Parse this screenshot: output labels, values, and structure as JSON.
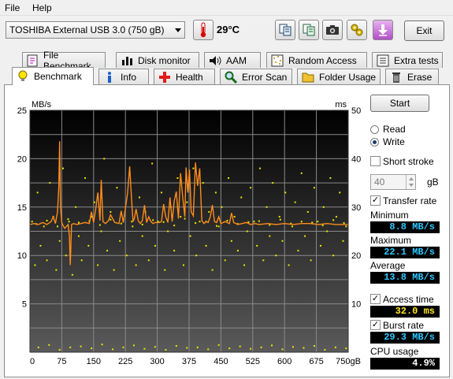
{
  "menu": {
    "file": "File",
    "help": "Help"
  },
  "toolbar": {
    "drive": "TOSHIBA External USB 3.0 (750 gB)",
    "temperature": "29°C",
    "exit_label": "Exit"
  },
  "tabs_top": [
    {
      "label": "File Benchmark",
      "icon": "file-benchmark-icon"
    },
    {
      "label": "Disk monitor",
      "icon": "disk-monitor-icon"
    },
    {
      "label": "AAM",
      "icon": "speaker-icon"
    },
    {
      "label": "Random Access",
      "icon": "random-access-icon"
    },
    {
      "label": "Extra tests",
      "icon": "extra-tests-icon"
    }
  ],
  "tabs_bottom": [
    {
      "label": "Benchmark",
      "icon": "lightbulb-icon"
    },
    {
      "label": "Info",
      "icon": "info-icon"
    },
    {
      "label": "Health",
      "icon": "health-cross-icon"
    },
    {
      "label": "Error Scan",
      "icon": "magnifier-icon"
    },
    {
      "label": "Folder Usage",
      "icon": "folder-icon"
    },
    {
      "label": "Erase",
      "icon": "trash-icon"
    }
  ],
  "side": {
    "start_label": "Start",
    "read_label": "Read",
    "write_label": "Write",
    "mode": "write",
    "short_stroke_label": "Short stroke",
    "short_stroke_checked": false,
    "short_stroke_value": "40",
    "short_stroke_unit": "gB",
    "transfer_rate_label": "Transfer rate",
    "transfer_rate_checked": true,
    "minimum_label": "Minimum",
    "minimum_value": "8.8 MB/s",
    "maximum_label": "Maximum",
    "maximum_value": "22.1 MB/s",
    "average_label": "Average",
    "average_value": "13.8 MB/s",
    "access_time_label": "Access time",
    "access_time_checked": true,
    "access_time_value": "32.0 ms",
    "burst_rate_label": "Burst rate",
    "burst_rate_checked": true,
    "burst_rate_value": "29.3 MB/s",
    "cpu_label": "CPU usage",
    "cpu_value": "4.9%"
  },
  "colors": {
    "chart_bg_top": "#000000",
    "chart_bg_bottom": "#5a5a5a",
    "transfer_line": "#ff8c1a",
    "access_points": "#e8e800",
    "grid": "#8a8a8a"
  },
  "chart_data": {
    "type": "line",
    "title": "",
    "ylabel": "MB/s",
    "y2label": "ms",
    "xunit": "gB",
    "x_ticks": [
      "0",
      "75",
      "150",
      "225",
      "300",
      "375",
      "450",
      "525",
      "600",
      "675",
      "750gB"
    ],
    "y_ticks": [
      "25",
      "20",
      "15",
      "10",
      "5"
    ],
    "y2_ticks": [
      "50",
      "40",
      "30",
      "20",
      "10"
    ],
    "xlim": [
      0,
      750
    ],
    "ylim": [
      0,
      25
    ],
    "y2lim": [
      0,
      50
    ],
    "grid": true,
    "series": [
      {
        "name": "Transfer rate",
        "axis": "left",
        "x": [
          0,
          10,
          20,
          30,
          40,
          50,
          55,
          60,
          65,
          68,
          70,
          72,
          75,
          78,
          82,
          86,
          90,
          93,
          95,
          98,
          103,
          110,
          120,
          130,
          140,
          145,
          150,
          155,
          160,
          165,
          168,
          172,
          178,
          185,
          190,
          200,
          210,
          215,
          220,
          225,
          230,
          235,
          240,
          243,
          246,
          250,
          255,
          260,
          265,
          270,
          275,
          280,
          285,
          290,
          295,
          300,
          305,
          310,
          315,
          320,
          325,
          330,
          335,
          340,
          345,
          350,
          355,
          360,
          365,
          368,
          372,
          376,
          380,
          385,
          390,
          395,
          400,
          405,
          410,
          415,
          420,
          425,
          430,
          435,
          440,
          445,
          450,
          460,
          470,
          475,
          480,
          490,
          500,
          510,
          520,
          530,
          540,
          560,
          580,
          600,
          620,
          640,
          660,
          680,
          700,
          720,
          740,
          750
        ],
        "values": [
          13.2,
          13.3,
          13.2,
          13.4,
          13.2,
          13.5,
          14.0,
          13.3,
          14.5,
          17.0,
          21.8,
          15.0,
          13.4,
          13.1,
          12.8,
          13.0,
          13.2,
          12.0,
          9.0,
          13.2,
          13.3,
          13.2,
          13.3,
          13.4,
          13.3,
          14.5,
          13.4,
          14.8,
          16.5,
          13.6,
          17.8,
          13.5,
          13.3,
          13.6,
          14.2,
          13.4,
          13.3,
          14.6,
          13.4,
          14.9,
          16.4,
          19.2,
          15.4,
          13.5,
          13.8,
          14.8,
          13.6,
          13.3,
          13.6,
          15.2,
          13.4,
          14.0,
          13.5,
          13.3,
          13.4,
          13.4,
          13.4,
          13.5,
          15.3,
          14.0,
          13.4,
          16.0,
          13.5,
          15.6,
          16.6,
          13.8,
          18.5,
          16.0,
          14.0,
          19.1,
          16.5,
          18.9,
          14.5,
          14.1,
          19.6,
          17.2,
          19.0,
          13.6,
          13.3,
          13.5,
          13.4,
          14.0,
          15.2,
          13.5,
          13.4,
          14.0,
          13.3,
          13.5,
          13.3,
          14.4,
          13.4,
          13.2,
          13.3,
          13.4,
          13.2,
          13.3,
          13.2,
          13.3,
          13.2,
          13.3,
          13.2,
          13.3,
          13.3,
          13.2,
          13.3,
          13.2,
          13.2,
          13.2
        ]
      },
      {
        "name": "Access time",
        "axis": "right",
        "type": "scatter",
        "x": [
          5,
          12,
          18,
          25,
          33,
          40,
          47,
          55,
          62,
          70,
          78,
          85,
          92,
          100,
          108,
          115,
          122,
          130,
          138,
          145,
          152,
          160,
          168,
          175,
          182,
          190,
          198,
          205,
          212,
          220,
          228,
          235,
          242,
          250,
          258,
          265,
          272,
          280,
          288,
          295,
          302,
          310,
          318,
          325,
          332,
          340,
          348,
          355,
          362,
          370,
          378,
          385,
          392,
          400,
          408,
          415,
          422,
          430,
          438,
          445,
          452,
          460,
          468,
          475,
          482,
          490,
          498,
          505,
          512,
          520,
          528,
          535,
          542,
          550,
          558,
          565,
          572,
          580,
          588,
          595,
          602,
          610,
          618,
          625,
          632,
          640,
          648,
          655,
          662,
          670,
          678,
          685,
          692,
          700,
          708,
          715,
          722,
          730,
          738,
          745,
          20,
          45,
          70,
          95,
          120,
          145,
          170,
          195,
          220,
          245,
          270,
          295,
          320,
          345,
          370,
          395,
          420,
          445,
          470,
          495,
          520,
          545,
          570,
          595,
          620,
          645,
          670,
          695,
          720,
          745,
          15,
          40,
          65,
          90,
          115,
          140,
          165,
          190,
          215,
          240,
          265,
          290,
          315,
          340,
          365,
          390,
          415,
          440,
          465,
          490,
          515,
          540,
          565,
          590,
          615,
          640,
          665,
          690,
          715,
          740
        ],
        "values": [
          27,
          18,
          33,
          22,
          26,
          19,
          35,
          28,
          17,
          23,
          38,
          20,
          27,
          16,
          30,
          24,
          19,
          36,
          22,
          28,
          31,
          18,
          25,
          40,
          21,
          29,
          17,
          34,
          23,
          27,
          20,
          37,
          26,
          18,
          32,
          24,
          29,
          19,
          39,
          22,
          27,
          33,
          17,
          25,
          30,
          21,
          36,
          28,
          18,
          31,
          24,
          38,
          20,
          27,
          35,
          22,
          29,
          17,
          33,
          26,
          30,
          19,
          36,
          23,
          28,
          21,
          32,
          18,
          25,
          34,
          27,
          22,
          38,
          19,
          30,
          24,
          35,
          20,
          28,
          23,
          33,
          18,
          26,
          31,
          21,
          37,
          24,
          29,
          19,
          34,
          27,
          22,
          30,
          25,
          36,
          20,
          28,
          33,
          23,
          26,
          1,
          1.5,
          0.5,
          1,
          1.2,
          0.8,
          1.6,
          0.6,
          1,
          1.4,
          0.7,
          1.1,
          0.5,
          1.3,
          0.9,
          1,
          0.6,
          1.5,
          0.8,
          1.2,
          0.7,
          1,
          1.4,
          0.6,
          1.1,
          0.9,
          1.3,
          0.5,
          1,
          0.8,
          26.5,
          27.2,
          26.0,
          27.5,
          26.8,
          27.1,
          26.3,
          27.4,
          26.6,
          27.0,
          26.4,
          27.3,
          26.9,
          26.2,
          27.6,
          26.7,
          27.0,
          26.1,
          27.2,
          26.5,
          26.9,
          27.1,
          26.3,
          27.4,
          26.6,
          27.0,
          26.8,
          26.2,
          27.3,
          26.7
        ]
      }
    ]
  }
}
